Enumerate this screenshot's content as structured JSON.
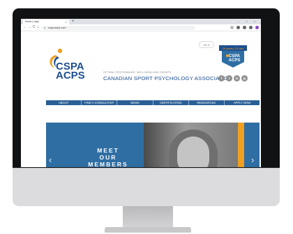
{
  "browser": {
    "tab_title": "Home | cspa",
    "tab_close": "×",
    "new_tab": "+",
    "window_controls": "– □ ×",
    "nav_back": "←",
    "nav_forward": "→",
    "nav_reload": "C",
    "nav_home": "⌂",
    "url": "cspa-acps.com"
  },
  "site": {
    "language": "EN",
    "logo_line1": "CSPA",
    "logo_line2": "ACPS",
    "tagline": "OPTIMAL PERFORMANCE, WELL-BEING AND GROWTH",
    "association_name": "CANADIAN SPORT PSYCHOLOGY ASSOCIATION",
    "badge_top": "25 years | 25 ans",
    "badge_mid1": "CSPA",
    "badge_mid2": "ACPS",
    "social": [
      "f",
      "t",
      "in",
      "◎"
    ],
    "menu": [
      "ABOUT",
      "FIND A CONSULTANT",
      "NEWS",
      "CERTIFICATION",
      "RESOURCES",
      "APPLY NOW"
    ],
    "hero_lines": [
      "MEET",
      "OUR",
      "MEMBERS"
    ],
    "arrow_left": "‹",
    "arrow_right": "›"
  },
  "colors": {
    "brand_blue": "#1d4f91",
    "menu_blue": "#2a5f95",
    "hero_blue": "#2f6ea3",
    "accent_orange": "#f0a020"
  }
}
